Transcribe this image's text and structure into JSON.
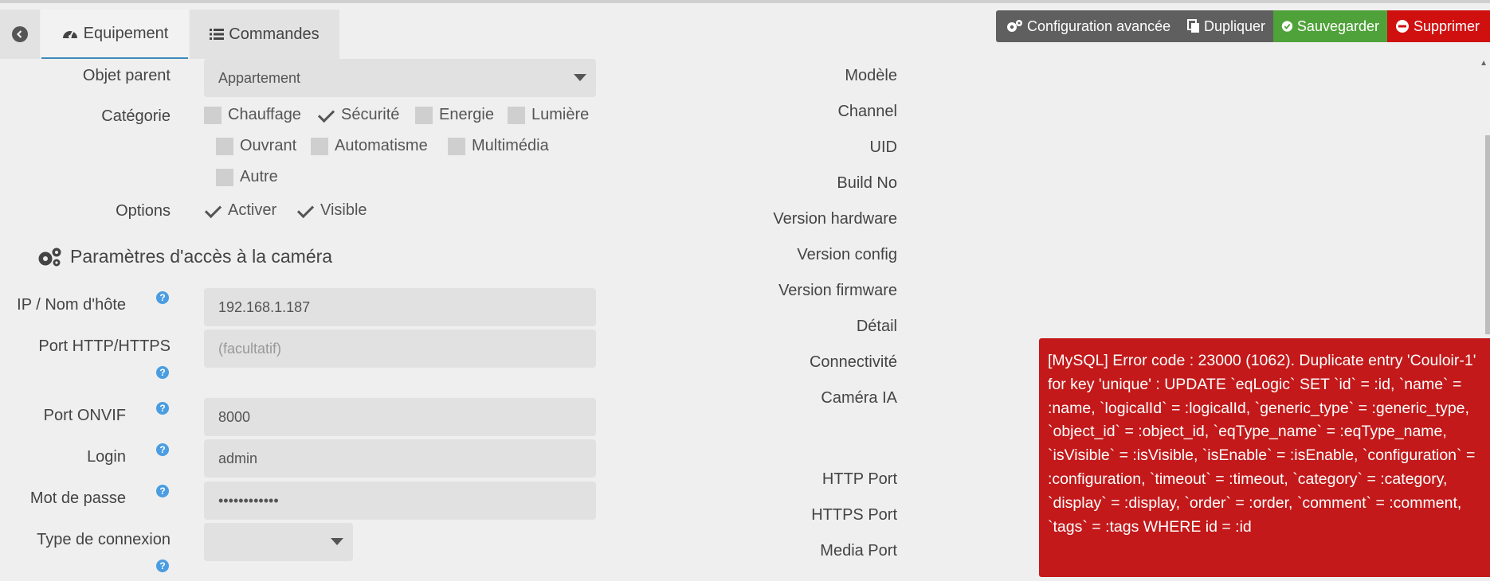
{
  "tabs": {
    "equipement": "Equipement",
    "commandes": "Commandes"
  },
  "actions": {
    "config": "Configuration avancée",
    "dup": "Dupliquer",
    "save": "Sauvegarder",
    "del": "Supprimer"
  },
  "form": {
    "parent_label": "Objet parent",
    "parent_value": "Appartement",
    "categorie_label": "Catégorie",
    "categories": [
      {
        "label": "Chauffage",
        "checked": false
      },
      {
        "label": "Sécurité",
        "checked": true
      },
      {
        "label": "Energie",
        "checked": false
      },
      {
        "label": "Lumière",
        "checked": false
      },
      {
        "label": "Ouvrant",
        "checked": false
      },
      {
        "label": "Automatisme",
        "checked": false
      },
      {
        "label": "Multimédia",
        "checked": false
      },
      {
        "label": "Autre",
        "checked": false
      }
    ],
    "options_label": "Options",
    "options": [
      {
        "label": "Activer",
        "checked": true
      },
      {
        "label": "Visible",
        "checked": true
      }
    ],
    "section_title": "Paramètres d'accès à la caméra",
    "ip_label": "IP / Nom d'hôte",
    "ip_value": "192.168.1.187",
    "port_http_label": "Port HTTP/HTTPS",
    "port_http_placeholder": "(facultatif)",
    "port_onvif_label": "Port ONVIF",
    "port_onvif_value": "8000",
    "login_label": "Login",
    "login_value": "admin",
    "password_label": "Mot de passe",
    "password_value": "••••••••••••",
    "conn_label": "Type de connexion",
    "help_glyph": "?"
  },
  "right_labels": {
    "modele": "Modèle",
    "channel": "Channel",
    "uid": "UID",
    "build": "Build No",
    "hw": "Version hardware",
    "config": "Version config",
    "fw": "Version firmware",
    "detail": "Détail",
    "conn": "Connectivité",
    "ia": "Caméra IA",
    "http": "HTTP Port",
    "https": "HTTPS Port",
    "media": "Media Port"
  },
  "error": {
    "message": "[MySQL] Error code : 23000 (1062). Duplicate entry 'Couloir-1' for key 'unique' : UPDATE `eqLogic` SET `id` = :id, `name` = :name, `logicalId` = :logicalId, `generic_type` = :generic_type, `object_id` = :object_id, `eqType_name` = :eqType_name, `isVisible` = :isVisible, `isEnable` = :isEnable, `configuration` = :configuration, `timeout` = :timeout, `category` = :category, `display` = :display, `order` = :order, `comment` = :comment, `tags` = :tags WHERE id = :id"
  },
  "colors": {
    "save": "#4fa23a",
    "delete": "#d00f0f",
    "dark": "#5f5f5f",
    "error": "#c3191a",
    "help": "#4a9de0"
  }
}
